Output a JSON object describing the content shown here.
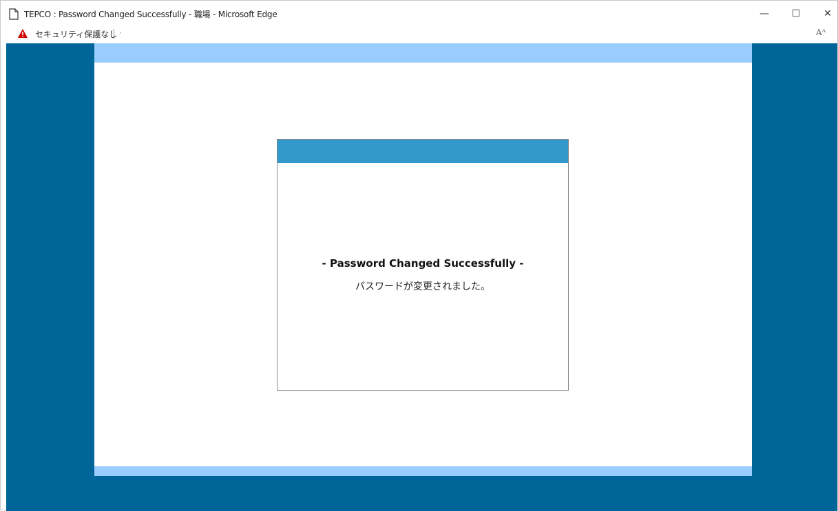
{
  "window": {
    "title": "TEPCO : Password Changed Successfully - 職場 - Microsoft Edge",
    "minimize_glyph": "—",
    "maximize_glyph": "☐",
    "close_glyph": "✕"
  },
  "addressbar": {
    "security_label": "セキュリティ保護なし",
    "url_text": "·",
    "read_aloud_glyph": "Aᴬ"
  },
  "dialog": {
    "heading": "- Password Changed Successfully -",
    "message": "パスワードが変更されました。"
  },
  "colors": {
    "page_background": "#006699",
    "band": "#99ccff",
    "dialog_header": "#3399cc",
    "warning": "#d00000"
  },
  "icons": {
    "page": "page-icon",
    "warning": "warning-icon",
    "minimize": "minimize-icon",
    "maximize": "maximize-icon",
    "close": "close-icon",
    "read_aloud": "read-aloud-icon"
  }
}
